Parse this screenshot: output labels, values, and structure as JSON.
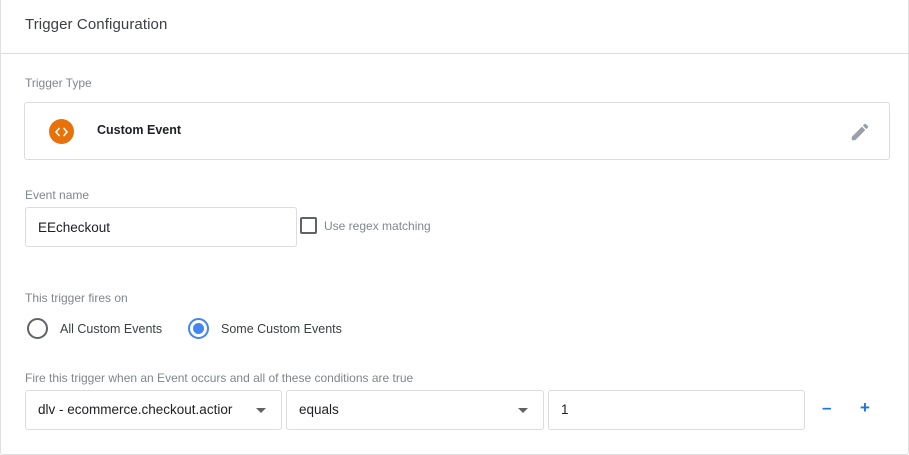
{
  "panel": {
    "title": "Trigger Configuration"
  },
  "trigger_type": {
    "label": "Trigger Type",
    "selected_name": "Custom Event",
    "icon": "code-brackets-icon",
    "icon_glyph": "<>",
    "icon_color": "#e8710a",
    "edit_icon": "pencil-icon"
  },
  "event_name": {
    "label": "Event name",
    "value": "EEcheckout",
    "regex_label": "Use regex matching",
    "regex_checked": false
  },
  "fires_on": {
    "label": "This trigger fires on",
    "options": [
      {
        "label": "All Custom Events",
        "selected": false
      },
      {
        "label": "Some Custom Events",
        "selected": true
      }
    ]
  },
  "conditions": {
    "label": "Fire this trigger when an Event occurs and all of these conditions are true",
    "rows": [
      {
        "variable": "dlv - ecommerce.checkout.actior",
        "operator": "equals",
        "value": "1"
      }
    ],
    "remove_label": "–",
    "add_label": "+"
  },
  "colors": {
    "accent": "#4285f4",
    "link": "#1a73e8",
    "border": "#dadce0"
  }
}
